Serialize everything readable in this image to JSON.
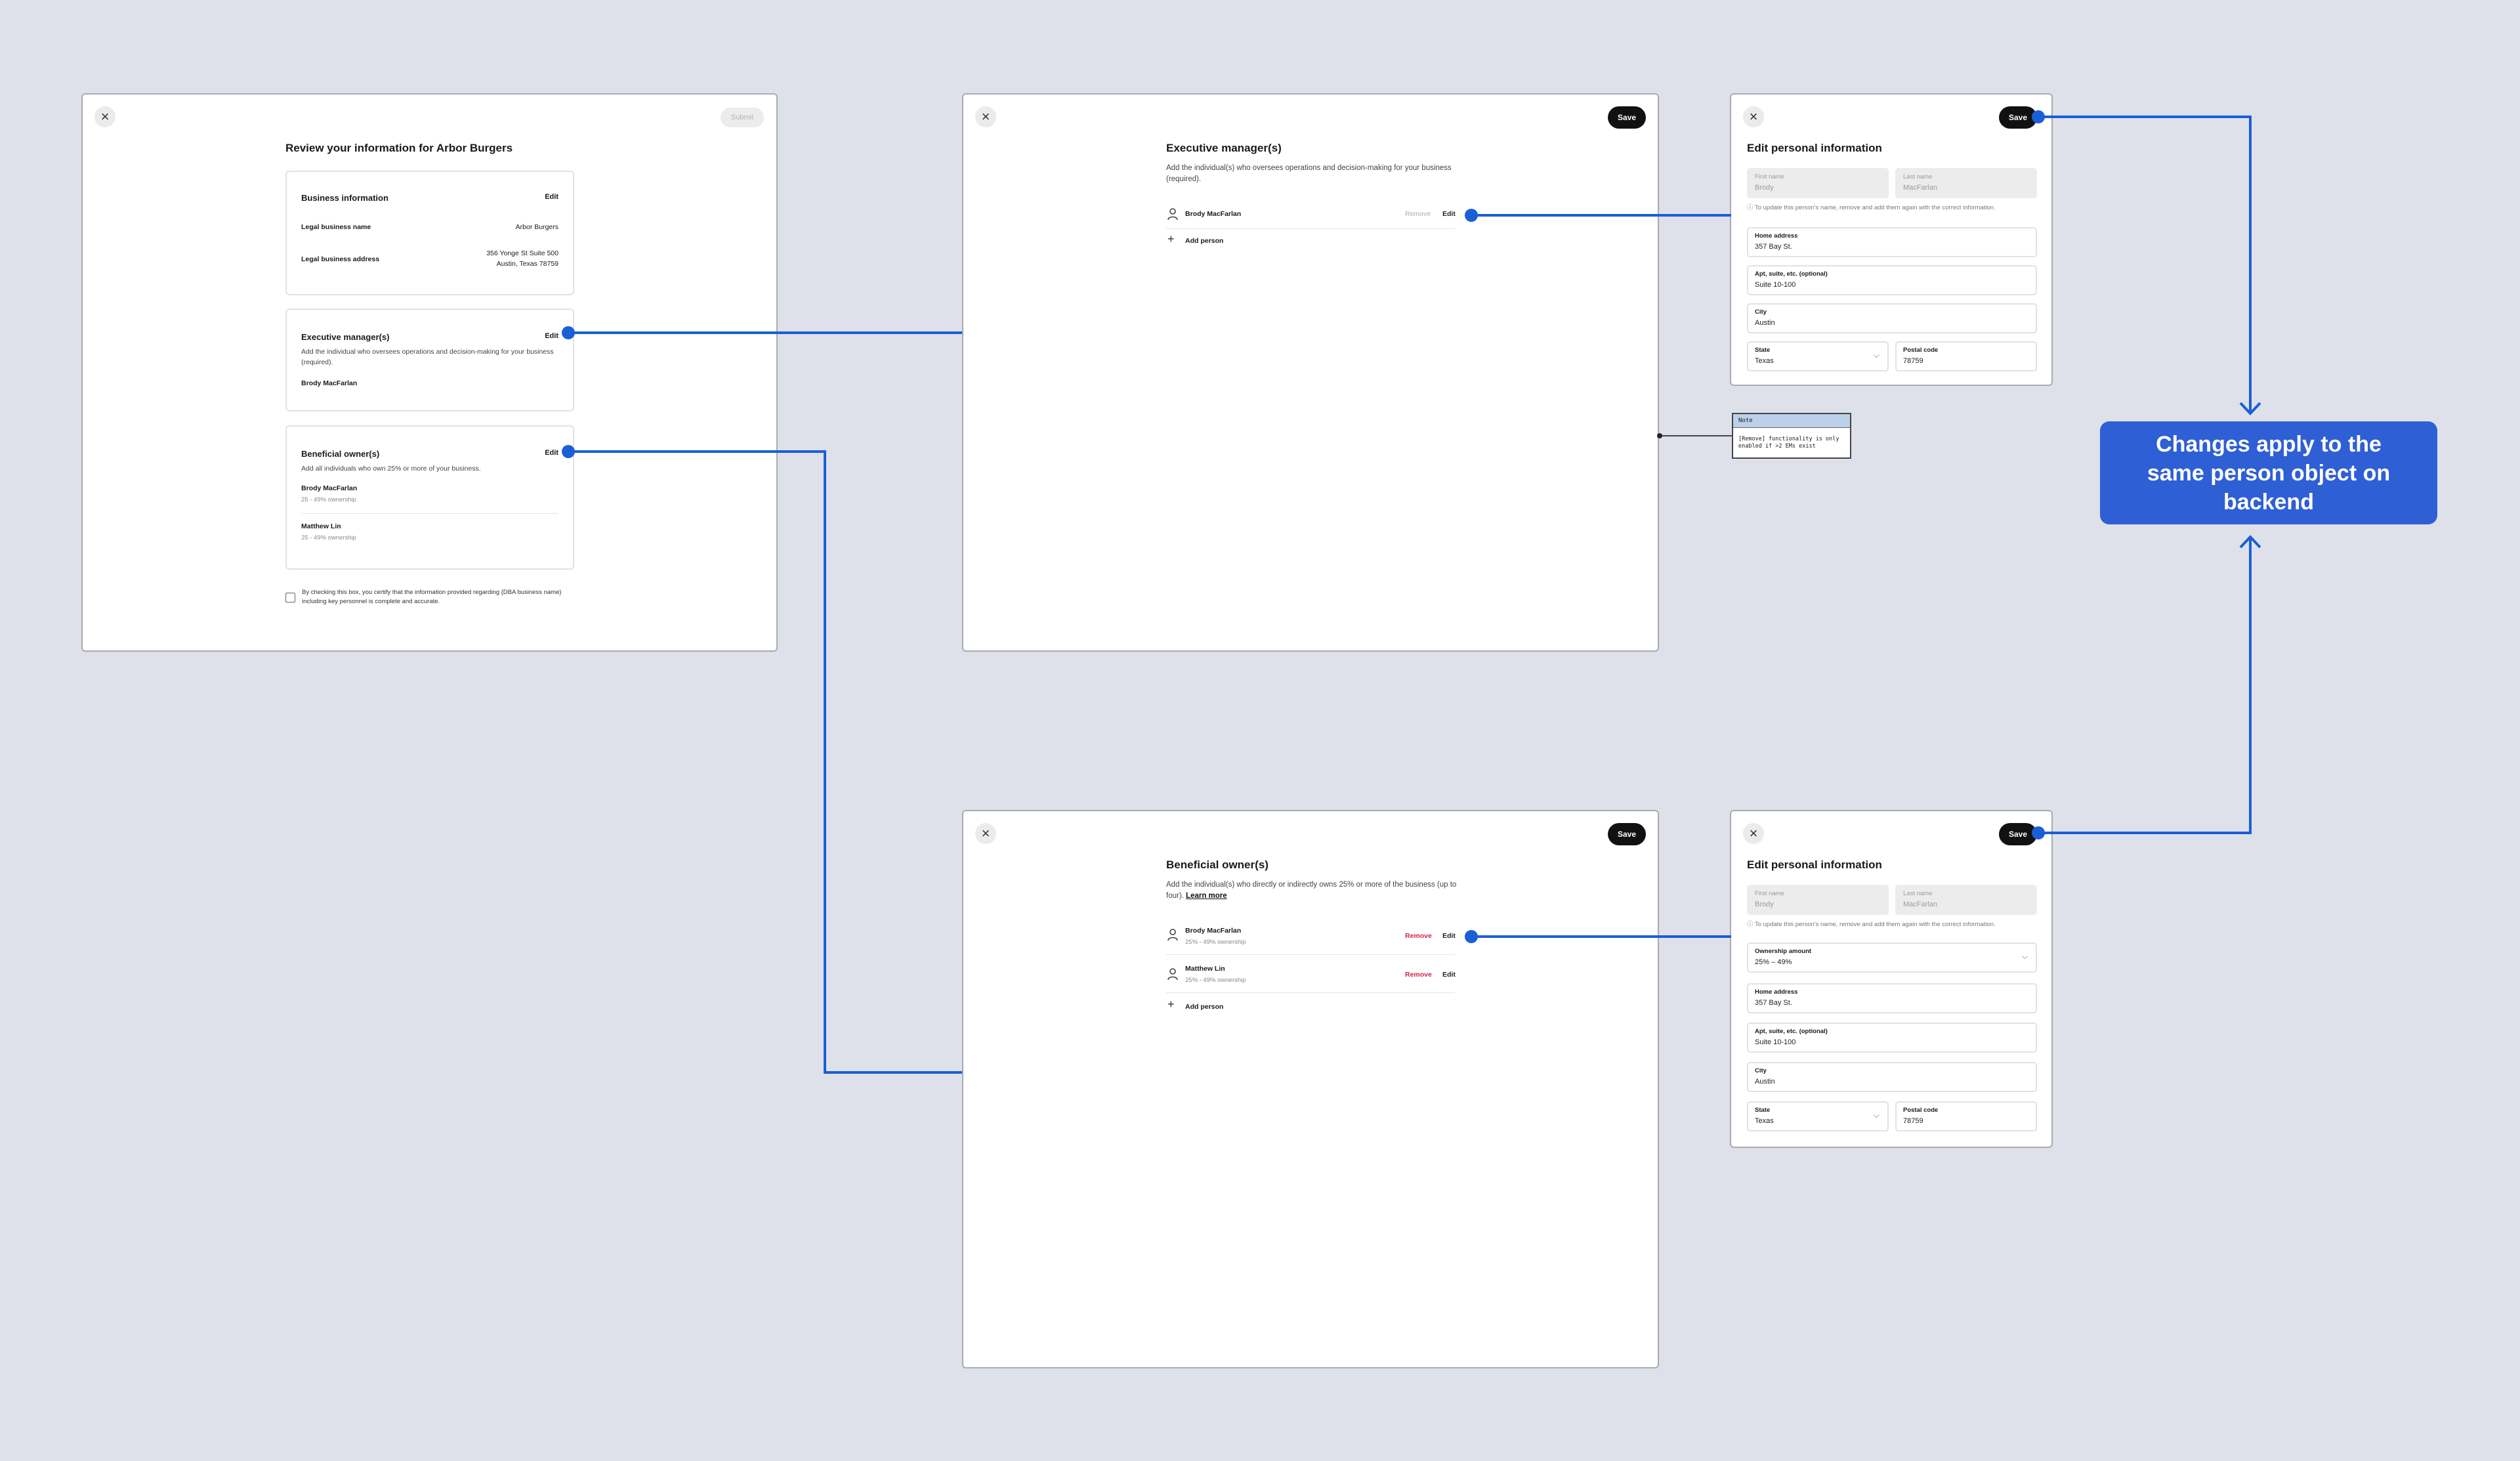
{
  "review": {
    "title": "Review your information for Arbor Burgers",
    "submit_label": "Submit",
    "business": {
      "title": "Business information",
      "edit": "Edit",
      "name_label": "Legal business name",
      "name_value": "Arbor Burgers",
      "address_label": "Legal business address",
      "address_line1": "356 Yonge St Suite 500",
      "address_line2": "Austin, Texas 78759"
    },
    "exec": {
      "title": "Executive manager(s)",
      "edit": "Edit",
      "desc": "Add the individual who oversees operations and decision-making for your business (required).",
      "person": "Brody MacFarlan"
    },
    "owners": {
      "title": "Beneficial owner(s)",
      "edit": "Edit",
      "desc": "Add all individuals who own 25% or more of your business.",
      "people": [
        {
          "name": "Brody MacFarlan",
          "ownership": "25 - 49% ownership"
        },
        {
          "name": "Matthew Lin",
          "ownership": "25 - 49% ownership"
        }
      ]
    },
    "certify": "By checking this box, you certify that the information provided regarding {DBA business name} including key personnel is complete and accurate."
  },
  "exec_page": {
    "title": "Executive manager(s)",
    "desc": "Add the individual(s) who oversees operations and decision-making for your business (required).",
    "save_label": "Save",
    "person": "Brody MacFarlan",
    "remove": "Remove",
    "edit": "Edit",
    "add_person": "Add person"
  },
  "owners_page": {
    "title": "Beneficial owner(s)",
    "desc": "Add the individual(s) who directly or indirectly owns 25% or more of the business (up to four).",
    "learn_more": "Learn more",
    "save_label": "Save",
    "people": [
      {
        "name": "Brody MacFarlan",
        "ownership": "25% - 49% ownership"
      },
      {
        "name": "Matthew Lin",
        "ownership": "25% - 49% ownership"
      }
    ],
    "remove": "Remove",
    "edit": "Edit",
    "add_person": "Add person"
  },
  "edit_form": {
    "title": "Edit personal information",
    "save_label": "Save",
    "first_name_label": "First name",
    "first_name_value": "Brody",
    "last_name_label": "Last name",
    "last_name_value": "MacFarlan",
    "hint": "To update this person's name, remove and add them again with the correct information.",
    "ownership_label": "Ownership amount",
    "ownership_value": "25% – 49%",
    "home_label": "Home address",
    "home_value": "357 Bay St.",
    "apt_label": "Apt, suite, etc. (optional)",
    "apt_value": "Suite 10-100",
    "city_label": "City",
    "city_value": "Austin",
    "state_label": "State",
    "state_value": "Texas",
    "postal_label": "Postal code",
    "postal_value": "78759"
  },
  "note": {
    "title": "Note",
    "body": "[Remove] functionality is only enabled if >2 EMs exist"
  },
  "callout": "Changes apply to the same person object on backend",
  "colors": {
    "connector": "#1a5fd6",
    "callout_bg": "#2f5fd5",
    "remove_red": "#d0264c",
    "canvas": "#dfe1ea"
  }
}
